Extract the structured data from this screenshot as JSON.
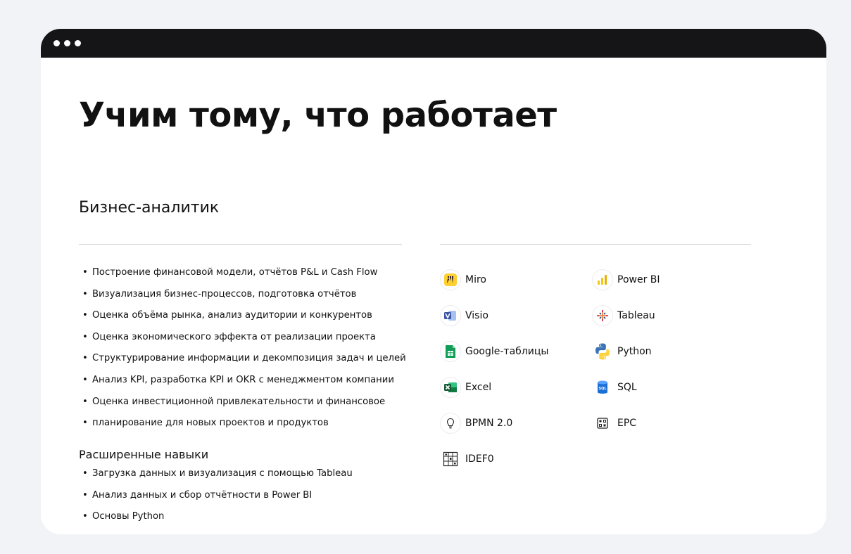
{
  "page": {
    "title": "Учим тому, что работает",
    "subtitle": "Бизнес-аналитик"
  },
  "skills": [
    "Построение финансовой модели, отчётов P&L и Cash Flow",
    "Визуализация бизнес-процессов, подготовка отчётов",
    "Оценка объёма рынка, анализ аудитории и конкурентов",
    "Оценка экономического эффекта от реализации проекта",
    "Структурирование информации и декомпозиция задач и целей",
    "Анализ KPI, разработка KPI и OKR с менеджментом компании",
    "Оценка инвестиционной привлекательности и финансовое",
    "планирование для новых проектов и продуктов"
  ],
  "advanced": {
    "title": "Расширенные навыки",
    "items": [
      "Загрузка данных и визуализация с помощью Tableau",
      "Анализ данных и сбор отчётности в Power BI",
      "Основы Python"
    ]
  },
  "bullet": "•",
  "tools": [
    {
      "label": "Miro",
      "icon": "miro-icon"
    },
    {
      "label": "Power BI",
      "icon": "power-bi-icon"
    },
    {
      "label": "Visio",
      "icon": "visio-icon"
    },
    {
      "label": "Tableau",
      "icon": "tableau-icon"
    },
    {
      "label": "Google-таблицы",
      "icon": "google-sheets-icon"
    },
    {
      "label": "Python",
      "icon": "python-icon"
    },
    {
      "label": "Excel",
      "icon": "excel-icon"
    },
    {
      "label": "SQL",
      "icon": "sql-icon"
    },
    {
      "label": "BPMN 2.0",
      "icon": "bpmn-icon"
    },
    {
      "label": "EPC",
      "icon": "epc-icon"
    },
    {
      "label": "IDEF0",
      "icon": "idef0-icon"
    }
  ],
  "colors": {
    "background": "#f2f3f6",
    "titlebar": "#151517",
    "card": "#ffffff"
  }
}
